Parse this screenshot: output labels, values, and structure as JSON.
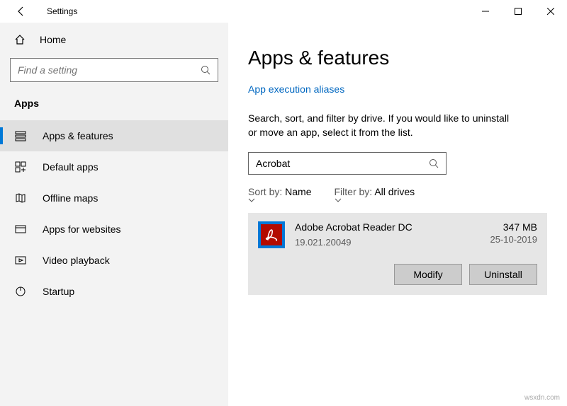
{
  "window": {
    "title": "Settings"
  },
  "sidebar": {
    "home": "Home",
    "search_placeholder": "Find a setting",
    "section": "Apps",
    "items": [
      {
        "label": "Apps & features"
      },
      {
        "label": "Default apps"
      },
      {
        "label": "Offline maps"
      },
      {
        "label": "Apps for websites"
      },
      {
        "label": "Video playback"
      },
      {
        "label": "Startup"
      }
    ]
  },
  "content": {
    "title": "Apps & features",
    "link": "App execution aliases",
    "description": "Search, sort, and filter by drive. If you would like to uninstall or move an app, select it from the list.",
    "search_value": "Acrobat",
    "sort_label": "Sort by:",
    "sort_value": "Name",
    "filter_label": "Filter by:",
    "filter_value": "All drives",
    "app": {
      "name": "Adobe Acrobat Reader DC",
      "version": "19.021.20049",
      "size": "347 MB",
      "date": "25-10-2019",
      "modify": "Modify",
      "uninstall": "Uninstall"
    }
  },
  "watermark": "wsxdn.com"
}
